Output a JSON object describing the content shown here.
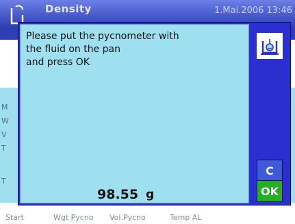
{
  "app": {
    "title": "Density",
    "datetime": "1.Mai.2006  13:46"
  },
  "background": {
    "labels": [
      "M",
      "W",
      "V",
      "T",
      "T"
    ]
  },
  "dialog": {
    "message_lines": [
      "Please put the pycnometer with",
      "the fluid on the pan",
      "and press OK"
    ],
    "weight_value": "98.55",
    "weight_unit": "g",
    "cancel_label": "C",
    "ok_label": "OK",
    "icon": "pycnometer-on-pan-icon"
  },
  "softkeys": {
    "items": [
      "Start",
      "Wgt Pycno",
      "Vol.Pycno",
      "Temp AL"
    ]
  },
  "colors": {
    "dialog_frame": "#2b2fd0",
    "dialog_body": "#9fe0f0",
    "ok_button": "#24b020",
    "cancel_button": "#3e5ad8"
  }
}
